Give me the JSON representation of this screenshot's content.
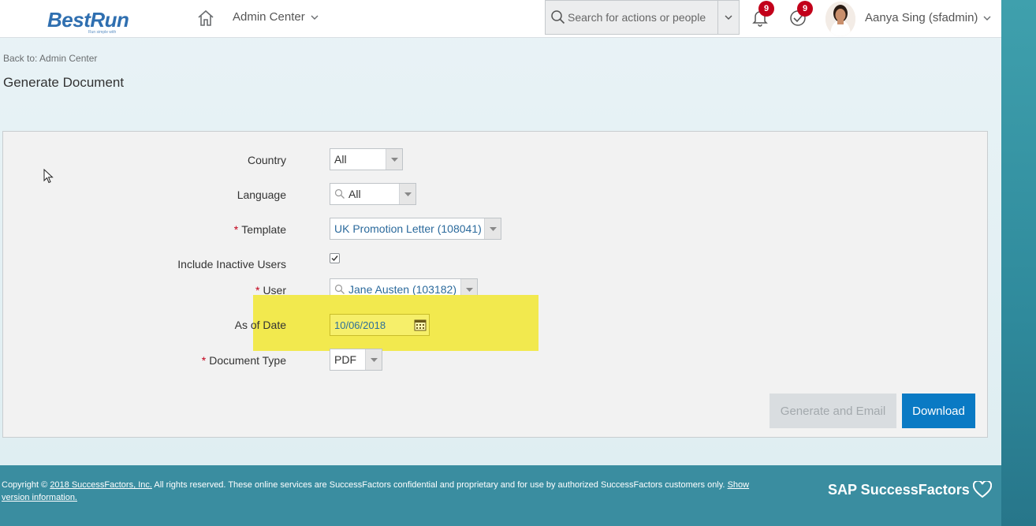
{
  "header": {
    "logo_text": "BestRun",
    "logo_tagline": "Run simple with",
    "nav_title": "Admin Center",
    "search_placeholder": "Search for actions or people",
    "notifications_count": "9",
    "todo_count": "9",
    "user_name": "Aanya Sing (sfadmin)"
  },
  "breadcrumb": {
    "back_link": "Back to: Admin Center"
  },
  "page": {
    "title": "Generate Document"
  },
  "form": {
    "country": {
      "label": "Country",
      "value": "All"
    },
    "language": {
      "label": "Language",
      "value": "All"
    },
    "template": {
      "label": "Template",
      "value": "UK Promotion Letter (108041)",
      "required": "*"
    },
    "include_inactive": {
      "label": "Include Inactive Users",
      "checked": true
    },
    "user": {
      "label": "User",
      "value": "Jane Austen (103182)",
      "required": "*"
    },
    "as_of_date": {
      "label": "As of Date",
      "value": "10/06/2018"
    },
    "document_type": {
      "label": "Document Type",
      "value": "PDF",
      "required": "*"
    }
  },
  "actions": {
    "generate_email": "Generate and Email",
    "download": "Download"
  },
  "footer": {
    "copyright_prefix": "Copyright ©",
    "copyright_link": "2018 SuccessFactors, Inc.",
    "copyright_body": "All rights reserved. These online services are SuccessFactors confidential and proprietary and for use by authorized SuccessFactors customers only.",
    "show_version": "Show version information.",
    "brand": "SAP SuccessFactors"
  },
  "colors": {
    "accent": "#0a7ac4",
    "highlight": "#f2e94e",
    "badge": "#c2001a",
    "footer_bg": "#3a8da0"
  }
}
